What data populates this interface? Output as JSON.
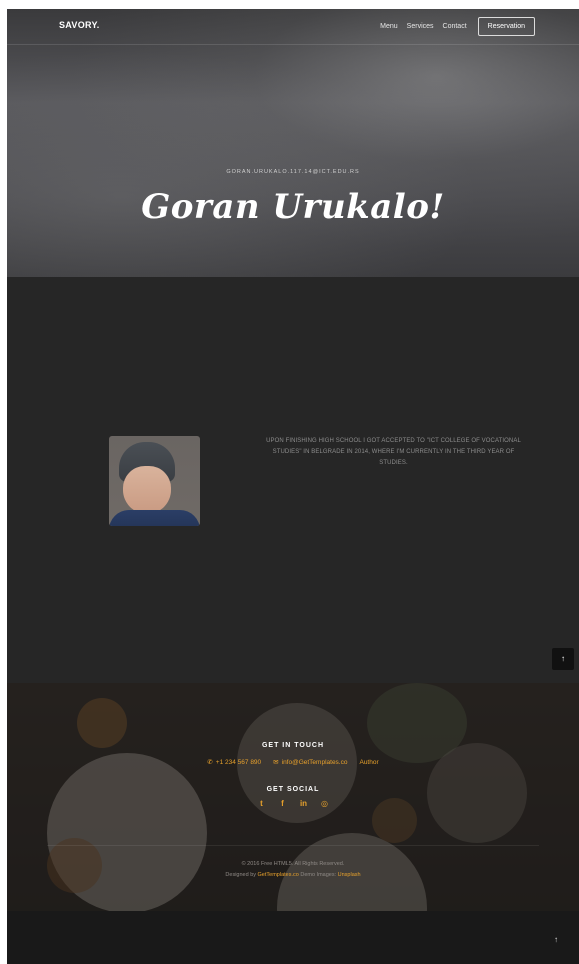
{
  "brand": {
    "logo": "SAVORY."
  },
  "nav": {
    "links": [
      "Menu",
      "Services",
      "Contact"
    ],
    "reservation": "Reservation"
  },
  "hero": {
    "email": "GORAN.URUKALO.117.14@ICT.EDU.RS",
    "title": "Goran Urukalo!"
  },
  "about": {
    "text": "UPON FINISHING HIGH SCHOOL I GOT ACCEPTED TO \"ICT COLLEGE OF VOCATIONAL STUDIES\" IN BELGRADE IN 2014, WHERE I'M CURRENTLY IN THE THIRD YEAR OF STUDIES."
  },
  "footer": {
    "get_in_touch": "GET IN TOUCH",
    "phone": "+1 234 567 890",
    "email": "info@GetTemplates.co",
    "author": "Author",
    "get_social": "GET SOCIAL",
    "social_icons": [
      "twitter-icon",
      "facebook-icon",
      "linkedin-icon",
      "dribbble-icon"
    ],
    "copyright": "© 2016 Free HTML5. All Rights Reserved.",
    "credit_prefix": "Designed by ",
    "credit_link1": "GetTemplates.co",
    "credit_mid": " Demo Images: ",
    "credit_link2": "Unsplash"
  },
  "scroll_top": "↑",
  "colors": {
    "accent": "#e7a12c",
    "dark": "#262626"
  }
}
